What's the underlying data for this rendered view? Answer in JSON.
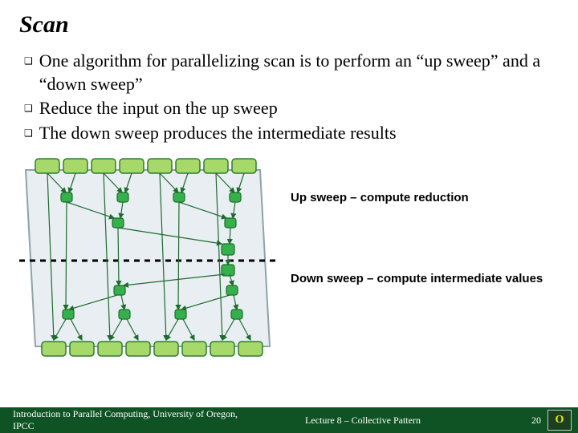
{
  "slide": {
    "title": "Scan",
    "bullets": [
      "One algorithm for parallelizing scan is to perform an “up sweep” and a “down sweep”",
      "Reduce the input on the up sweep",
      "The down sweep produces the intermediate results"
    ],
    "labels": {
      "up": "Up sweep – compute reduction",
      "down": "Down sweep – compute intermediate values"
    }
  },
  "footer": {
    "left": "Introduction to Parallel Computing, University of Oregon, IPCC",
    "center": "Lecture 8 – Collective Pattern",
    "page": "20",
    "logo_text": "O"
  },
  "diagram": {
    "top_cells": 8,
    "bottom_cells": 8,
    "cell_fill": "#a6d96a",
    "cell_stroke": "#2e7d32",
    "bg_fill": "#e8eef2",
    "bg_stroke": "#8fa4a8",
    "node_fill": "#36b04a",
    "node_stroke": "#1e6b2e",
    "edge_stroke": "#1e6b2e",
    "dash_stroke": "#000000"
  }
}
